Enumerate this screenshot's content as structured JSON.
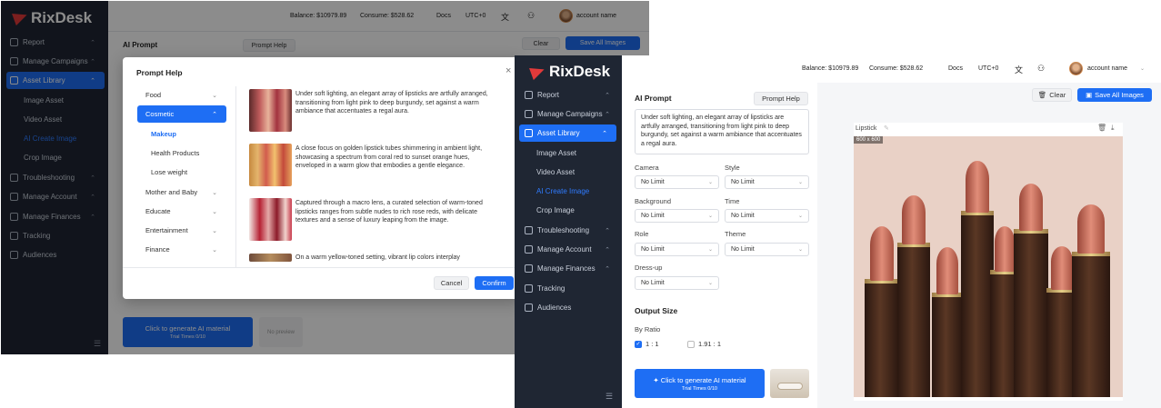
{
  "app": {
    "logo": "RixDesk",
    "balance": "Balance: $10979.89",
    "consume": "Consume: $528.62",
    "docs": "Docs",
    "timezone": "UTC+0",
    "account": "account name"
  },
  "sidebar": {
    "report": "Report",
    "manage_campaigns": "Manage Campaigns",
    "asset_library": "Asset Library",
    "image_asset": "Image Asset",
    "video_asset": "Video Asset",
    "ai_create_image": "AI Create Image",
    "crop_image": "Crop Image",
    "troubleshooting": "Troubleshooting",
    "manage_account": "Manage Account",
    "manage_finances": "Manage Finances",
    "tracking": "Tracking",
    "audiences": "Audiences"
  },
  "back": {
    "ai_prompt": "AI Prompt",
    "prompt_help": "Prompt Help",
    "clear": "Clear",
    "save_all": "Save All Images",
    "generate": "Click to generate AI material",
    "trial": "Trial Times 0/10",
    "no_preview": "No preview"
  },
  "modal": {
    "title": "Prompt Help",
    "close": "×",
    "categories": [
      "Food",
      "Cosmetic",
      "Mother and Baby",
      "Educate",
      "Entertainment",
      "Finance"
    ],
    "subcategories": [
      "Makeup",
      "Health Products",
      "Lose weight"
    ],
    "descriptions": [
      "Under soft lighting, an elegant array of lipsticks are artfully arranged, transitioning from light pink to deep burgundy, set against a warm ambiance that accentuates a regal aura.",
      "A close focus on golden lipstick tubes shimmering in ambient light, showcasing a spectrum from coral red to sunset orange hues, enveloped in a warm glow that embodies a gentle elegance.",
      "Captured through a macro lens, a curated selection of warm-toned lipsticks ranges from subtle nudes to rich rose reds, with delicate textures and a sense of luxury leaping from the image.",
      "On a warm yellow-toned setting, vibrant lip colors interplay"
    ],
    "cancel": "Cancel",
    "confirm": "Confirm"
  },
  "form": {
    "ai_prompt": "AI Prompt",
    "prompt_help": "Prompt Help",
    "prompt_text": "Under soft lighting, an elegant array of lipsticks are artfully arranged, transitioning from light pink to deep burgundy, set against a warm ambiance that accentuates a regal aura.",
    "camera": "Camera",
    "style": "Style",
    "background": "Background",
    "time": "Time",
    "role": "Role",
    "theme": "Theme",
    "dress_up": "Dress-up",
    "no_limit": "No Limit",
    "output_size": "Output Size",
    "by_ratio": "By Ratio",
    "ratio_1": "1 : 1",
    "ratio_2": "1.91 : 1",
    "generate": "Click to generate AI material",
    "trial": "Trial Times 0/10"
  },
  "preview": {
    "clear": "Clear",
    "save_all": "Save All Images",
    "name": "Lipstick",
    "size": "600 x 600"
  },
  "colors": {
    "sidebar": "#1f2633",
    "accent": "#1e6ef4",
    "logo_red": "#e23a3a"
  }
}
